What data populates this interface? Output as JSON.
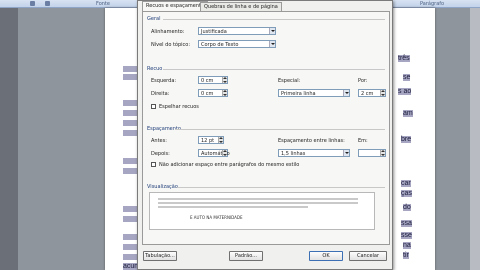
{
  "word": {
    "ribbon": {
      "group_font": "Fonte",
      "group_paragraph": "Parágrafo"
    },
    "doc_fragments": [
      {
        "text": "três"
      },
      {
        "text": "se"
      },
      {
        "text": "s ao"
      },
      {
        "text": "am"
      },
      {
        "text": "bre"
      },
      {
        "text": "car"
      },
      {
        "text": "ças"
      },
      {
        "text": "do"
      },
      {
        "text": "ssa"
      },
      {
        "text": "sse"
      },
      {
        "text": "na"
      },
      {
        "text": "tir"
      },
      {
        "text": "acumem pois mui"
      }
    ]
  },
  "dialog": {
    "tabs": [
      {
        "label": "Recuos e espaçamento"
      },
      {
        "label": "Quebras de linha e de página"
      }
    ],
    "general": {
      "title": "Geral",
      "alignment_label": "Alinhamento:",
      "alignment_value": "Justificada",
      "outline_label": "Nível do tópico:",
      "outline_value": "Corpo de Texto"
    },
    "indent": {
      "title": "Recuo",
      "left_label": "Esquerda:",
      "left_value": "0 cm",
      "right_label": "Direita:",
      "right_value": "0 cm",
      "special_label": "Especial:",
      "special_value": "Primeira linha",
      "by_label": "Por:",
      "by_value": "2 cm",
      "mirror_label": "Espelhar recuos"
    },
    "spacing": {
      "title": "Espaçamento",
      "before_label": "Antes:",
      "before_value": "12 pt",
      "after_label": "Depois:",
      "after_value": "Automático",
      "line_label": "Espaçamento entre linhas:",
      "line_value": "1,5 linhas",
      "at_label": "Em:",
      "at_value": "",
      "no_space_label": "Não adicionar espaço entre parágrafos do mesmo estilo"
    },
    "preview": {
      "title": "Visualização",
      "sample": "E AUTO NA MATERNIDADE"
    },
    "buttons": {
      "tabs": "Tabulação...",
      "default": "Padrão...",
      "ok": "OK",
      "cancel": "Cancelar"
    }
  }
}
